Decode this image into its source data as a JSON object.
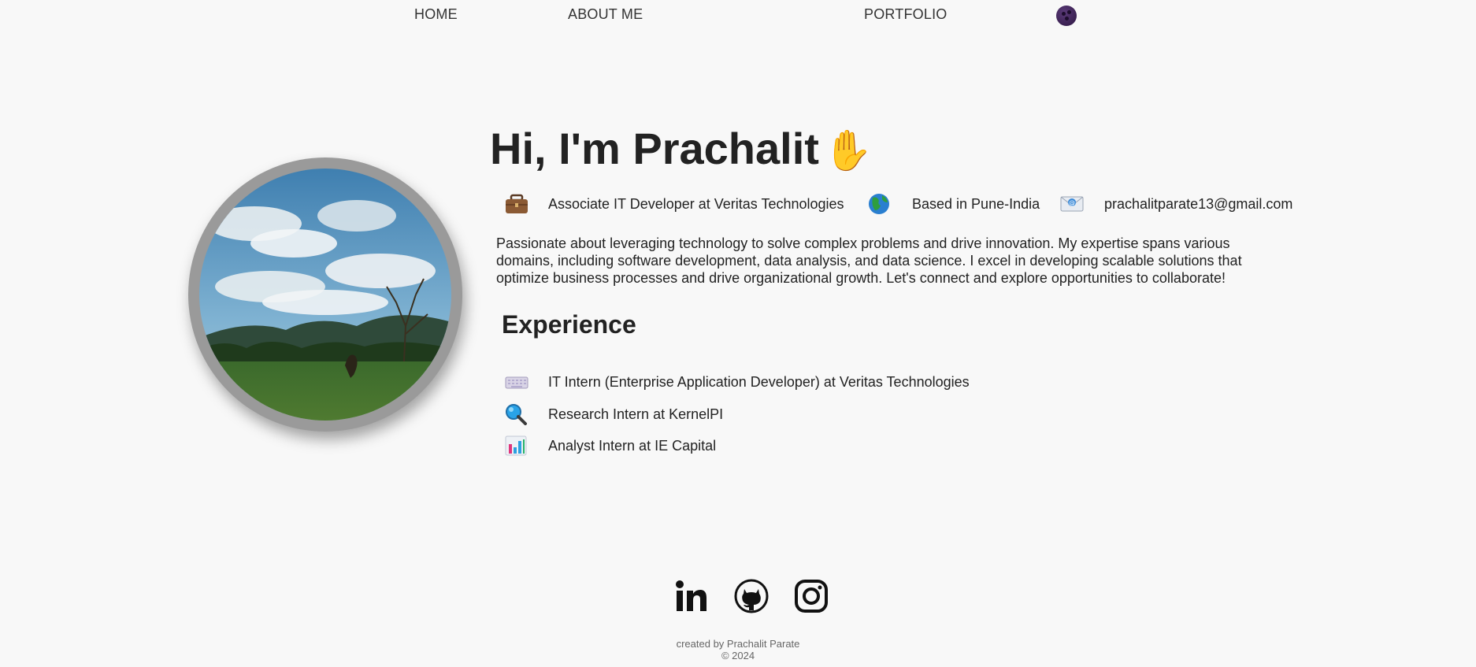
{
  "nav": {
    "home": "HOME",
    "about": "ABOUT ME",
    "portfolio": "PORTFOLIO"
  },
  "hero": {
    "title": "Hi, I'm Prachalit",
    "wave": "✋"
  },
  "info": {
    "role": "Associate IT Developer at Veritas Technologies",
    "location": "Based in Pune-India",
    "email": "prachalitparate13@gmail.com"
  },
  "bio": "Passionate about leveraging technology to solve complex problems and drive innovation. My expertise spans various domains, including software development, data analysis, and data science. I excel in developing scalable solutions that optimize business processes and drive organizational growth. Let's connect and explore opportunities to collaborate!",
  "experience": {
    "title": "Experience",
    "items": [
      {
        "label": "IT Intern (Enterprise Application Developer) at Veritas Technologies",
        "icon": "keyboard-icon"
      },
      {
        "label": "Research Intern at KernelPI",
        "icon": "magnifier-icon"
      },
      {
        "label": "Analyst Intern at IE Capital",
        "icon": "bar-chart-icon"
      }
    ]
  },
  "social": [
    "linkedin-icon",
    "github-icon",
    "instagram-icon"
  ],
  "footer": {
    "created_by": "created by Prachalit Parate",
    "copyright": "© 2024"
  },
  "colors": {
    "background": "#f8f8f8",
    "text": "#222222",
    "theme_toggle": "#3b2152"
  }
}
